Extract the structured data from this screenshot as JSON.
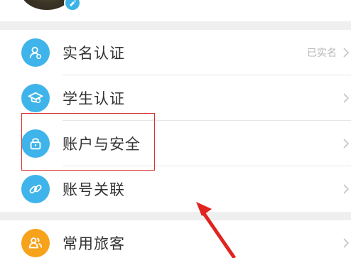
{
  "profile": {
    "avatar_icon": "user-avatar",
    "badge_icon": "edit-icon"
  },
  "group1": {
    "items": [
      {
        "label": "实名认证",
        "status": "已实名",
        "icon": "user-id-icon"
      },
      {
        "label": "学生认证",
        "status": "",
        "icon": "graduation-cap-icon"
      },
      {
        "label": "账户与安全",
        "status": "",
        "icon": "lock-icon"
      },
      {
        "label": "账号关联",
        "status": "",
        "icon": "link-icon"
      }
    ]
  },
  "group2": {
    "items": [
      {
        "label": "常用旅客",
        "status": "",
        "icon": "passengers-icon"
      }
    ]
  },
  "colors": {
    "accent_blue": "#3fb4ea",
    "accent_orange": "#f7a21b",
    "highlight_red": "#d9302e"
  }
}
